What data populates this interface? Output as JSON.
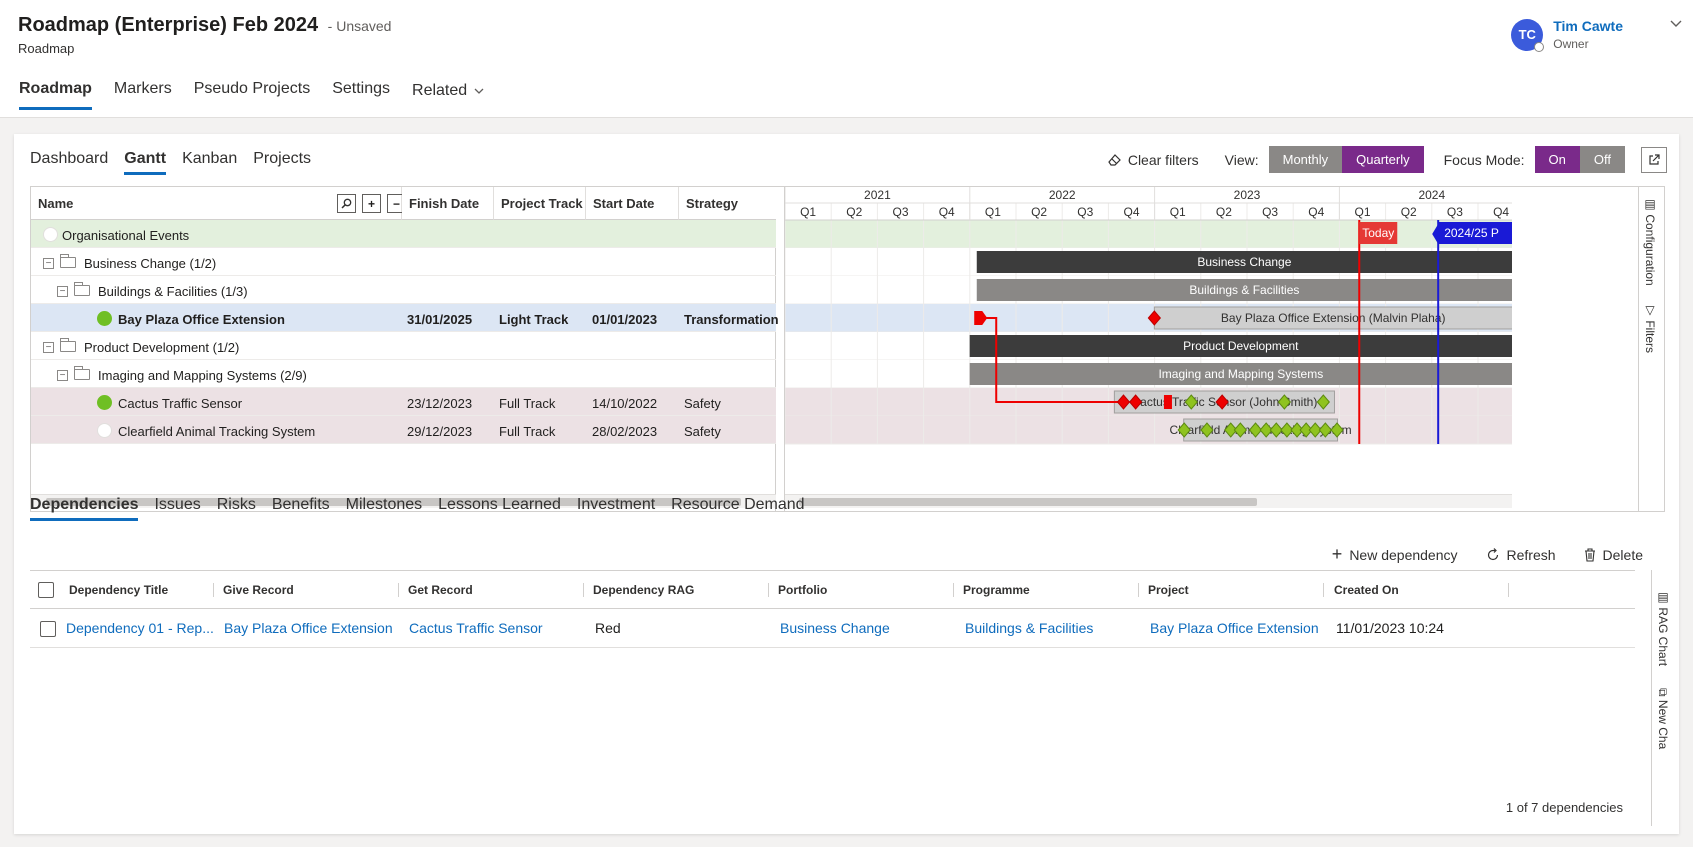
{
  "header": {
    "title": "Roadmap (Enterprise) Feb 2024",
    "unsaved": "- Unsaved",
    "subtitle": "Roadmap",
    "user": {
      "initials": "TC",
      "name": "Tim Cawte",
      "role": "Owner"
    },
    "nav": [
      "Roadmap",
      "Markers",
      "Pseudo Projects",
      "Settings",
      "Related"
    ]
  },
  "viewtabs": [
    "Dashboard",
    "Gantt",
    "Kanban",
    "Projects"
  ],
  "toolbar": {
    "clear_filters": "Clear filters",
    "view_label": "View:",
    "view_options": [
      "Monthly",
      "Quarterly"
    ],
    "view_selected": "Quarterly",
    "focus_label": "Focus Mode:",
    "focus_options": [
      "On",
      "Off"
    ],
    "focus_selected": "On"
  },
  "grid": {
    "columns": [
      "Name",
      "Finish Date",
      "Project Track",
      "Start Date",
      "Strategy"
    ],
    "rows": [
      {
        "name": "Organisational Events",
        "level": 0,
        "type": "event",
        "status": "white",
        "finish": "",
        "track": "",
        "start": "",
        "strategy": ""
      },
      {
        "name": "Business Change (1/2)",
        "level": 0,
        "type": "folder",
        "finish": "",
        "track": "",
        "start": "",
        "strategy": ""
      },
      {
        "name": "Buildings & Facilities (1/3)",
        "level": 1,
        "type": "folder",
        "finish": "",
        "track": "",
        "start": "",
        "strategy": ""
      },
      {
        "name": "Bay Plaza Office Extension",
        "level": 2,
        "type": "project",
        "status": "green",
        "finish": "31/01/2025",
        "track": "Light Track",
        "start": "01/01/2023",
        "strategy": "Transformation",
        "selected": true
      },
      {
        "name": "Product Development (1/2)",
        "level": 0,
        "type": "folder",
        "finish": "",
        "track": "",
        "start": "",
        "strategy": ""
      },
      {
        "name": "Imaging and Mapping Systems (2/9)",
        "level": 1,
        "type": "folder",
        "finish": "",
        "track": "",
        "start": "",
        "strategy": ""
      },
      {
        "name": "Cactus Traffic Sensor",
        "level": 2,
        "type": "project",
        "status": "green",
        "finish": "23/12/2023",
        "track": "Full Track",
        "start": "14/10/2022",
        "strategy": "Safety"
      },
      {
        "name": "Clearfield Animal Tracking System",
        "level": 2,
        "type": "project",
        "status": "white",
        "finish": "29/12/2023",
        "track": "Full Track",
        "start": "28/02/2023",
        "strategy": "Safety"
      }
    ]
  },
  "gantt": {
    "years": [
      "2021",
      "2022",
      "2023",
      "2024"
    ],
    "quarters": [
      "Q1",
      "Q2",
      "Q3",
      "Q4",
      "Q1",
      "Q2",
      "Q3",
      "Q4",
      "Q1",
      "Q2",
      "Q3",
      "Q4",
      "Q1",
      "Q2",
      "Q3",
      "Q4"
    ],
    "today_label": "Today",
    "marker_label": "2024/25 P",
    "bars": [
      {
        "row": 1,
        "label": "Business Change",
        "start": "2022-01-15",
        "end": "2025-06-30",
        "color": "#3c3c3c"
      },
      {
        "row": 2,
        "label": "Buildings & Facilities",
        "start": "2022-01-15",
        "end": "2025-06-30",
        "color": "#8a8886"
      },
      {
        "row": 3,
        "label": "Bay Plaza Office Extension (Malvin Plaha)",
        "start": "2023-01-01",
        "end": "2025-01-31",
        "color": "#cfcfcf"
      },
      {
        "row": 4,
        "label": "Product Development",
        "start": "2022-01-01",
        "end": "2025-06-30",
        "color": "#3c3c3c"
      },
      {
        "row": 5,
        "label": "Imaging and Mapping Systems",
        "start": "2022-01-01",
        "end": "2025-06-30",
        "color": "#8a8886"
      },
      {
        "row": 6,
        "label": "Cactus Traffic Sensor (John Smith)",
        "start": "2022-10-14",
        "end": "2023-12-23",
        "color": "#cfcfcf"
      },
      {
        "row": 7,
        "label": "Clearfield Animal Tracking System",
        "start": "2023-02-28",
        "end": "2023-12-29",
        "color": "#cfcfcf"
      }
    ],
    "side_labels": [
      "Configuration",
      "Filters"
    ]
  },
  "bottom": {
    "tabs": [
      "Dependencies",
      "Issues",
      "Risks",
      "Benefits",
      "Milestones",
      "Lessons Learned",
      "Investment",
      "Resource Demand"
    ],
    "actions": [
      "New dependency",
      "Refresh",
      "Delete"
    ],
    "columns": [
      "Dependency Title",
      "Give Record",
      "Get Record",
      "Dependency RAG",
      "Portfolio",
      "Programme",
      "Project",
      "Created On"
    ],
    "rows": [
      {
        "title": "Dependency 01 - Rep...",
        "give": "Bay Plaza Office Extension",
        "get": "Cactus Traffic Sensor",
        "rag": "Red",
        "portfolio": "Business Change",
        "programme": "Buildings & Facilities",
        "project": "Bay Plaza Office Extension",
        "created": "11/01/2023 10:24"
      }
    ],
    "count": "1 of 7 dependencies",
    "side_labels": [
      "RAG Chart",
      "New Cha"
    ]
  }
}
